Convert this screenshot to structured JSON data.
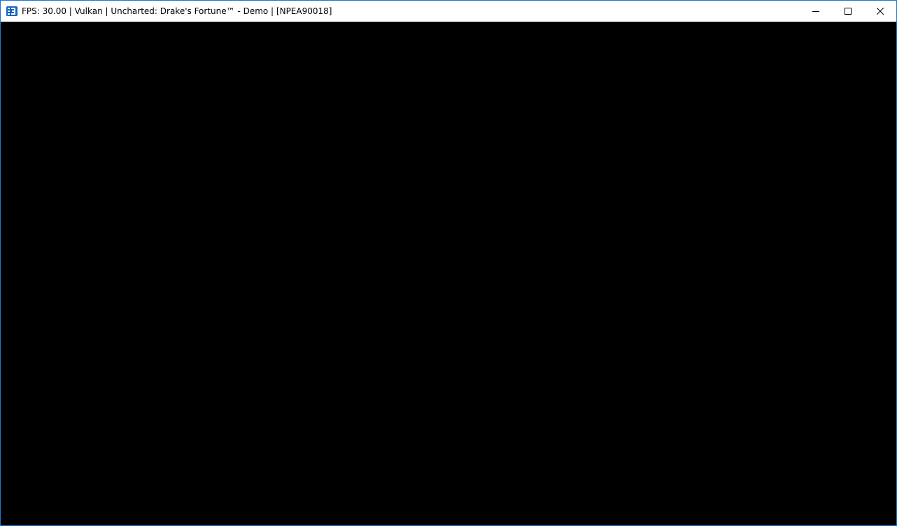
{
  "window": {
    "title": "FPS: 30.00 | Vulkan | Uncharted: Drake's Fortune™ - Demo | [NPEA90018]",
    "app_icon": "rpcs3-icon",
    "accent_color": "#1a78d6",
    "controls": {
      "minimize_icon": "minimize-icon",
      "maximize_icon": "maximize-icon",
      "close_icon": "close-icon"
    }
  },
  "viewport": {
    "background": "#000000"
  }
}
